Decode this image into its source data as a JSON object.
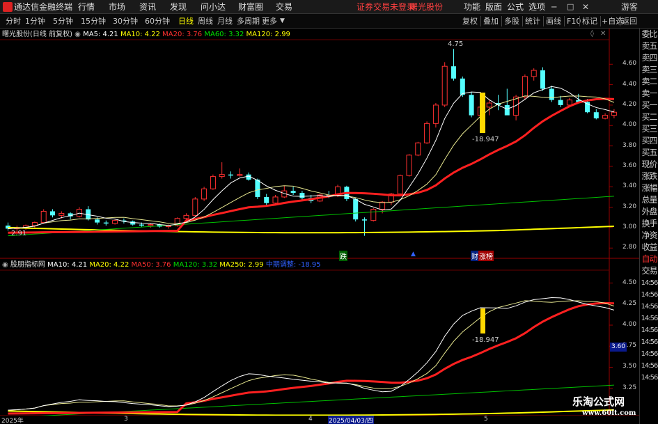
{
  "titlebar": {
    "app_name": "通达信金融终端",
    "menus": [
      "行情",
      "市场",
      "资讯",
      "发现",
      "问小达",
      "财富圈",
      "交易"
    ],
    "notice": "证券交易未登录",
    "stock_name": "曙光股份",
    "right_menus": [
      "功能",
      "版面",
      "公式",
      "选项"
    ],
    "guest": "游客"
  },
  "toolbar": {
    "periods": [
      "分时",
      "1分钟",
      "5分钟",
      "15分钟",
      "30分钟",
      "60分钟",
      "日线",
      "周线",
      "月线",
      "多周期",
      "更多"
    ],
    "active_period": "日线",
    "right_buttons": [
      "复权",
      "叠加",
      "多股",
      "统计",
      "画线",
      "F10",
      "标记",
      "+自选",
      "返回"
    ]
  },
  "main_chart": {
    "title": "曙光股份(日线 前复权)",
    "ma": [
      {
        "label": "MA5: 4.21",
        "color": "#ffffff"
      },
      {
        "label": "MA10: 4.22",
        "color": "#ffff00"
      },
      {
        "label": "MA20: 3.76",
        "color": "#ff3030"
      },
      {
        "label": "MA60: 3.32",
        "color": "#00e000"
      },
      {
        "label": "MA120: 2.99",
        "color": "#ffff00"
      }
    ],
    "high_label": "4.75",
    "low_label": "2.91",
    "marker_value": "-18.947",
    "y_ticks": [
      "4.60",
      "4.40",
      "4.20",
      "4.00",
      "3.80",
      "3.60",
      "3.40",
      "3.20",
      "3.00",
      "2.80"
    ],
    "event_labels": [
      "跌",
      "财",
      "涨榜"
    ]
  },
  "sub_chart": {
    "title": "股朋指标网",
    "ma": [
      {
        "label": "MA10: 4.21",
        "color": "#ffffff"
      },
      {
        "label": "MA20: 4.22",
        "color": "#ffff00"
      },
      {
        "label": "MA50: 3.76",
        "color": "#ff3030"
      },
      {
        "label": "MA120: 3.32",
        "color": "#00e000"
      },
      {
        "label": "MA250: 2.99",
        "color": "#ffff00"
      },
      {
        "label": "中期调整: -18.95",
        "color": "#3060ff"
      }
    ],
    "marker_value": "-18.947",
    "y_ticks": [
      "4.50",
      "4.25",
      "4.00",
      "3.75",
      "3.50",
      "3.25"
    ],
    "current_price_tag": "3.60"
  },
  "x_axis": {
    "labels": [
      "2025年",
      "3",
      "4",
      "2025/04/03/四",
      "5"
    ]
  },
  "right_panel": {
    "tabs": [
      "委比",
      "卖五",
      "卖四",
      "卖三",
      "卖二",
      "卖一",
      "买一",
      "买二",
      "买三",
      "买四",
      "买五",
      "现价",
      "涨跌",
      "涨幅",
      "总量",
      "外盘",
      "换手",
      "净资",
      "收益",
      "自动",
      "交易"
    ],
    "times": [
      "14:56",
      "14:56",
      "14:56",
      "14:56",
      "14:56",
      "14:56",
      "14:56",
      "14:56",
      "14:56"
    ]
  },
  "watermark": {
    "title": "乐淘公式网",
    "url": "www.60lt.com"
  },
  "chart_data": {
    "type": "candlestick",
    "candles": [
      [
        3.02,
        3.05,
        2.97,
        2.99
      ],
      [
        2.99,
        3.02,
        2.96,
        3.0
      ],
      [
        3.0,
        3.03,
        2.98,
        3.02
      ],
      [
        3.02,
        3.06,
        3.0,
        3.05
      ],
      [
        3.05,
        3.18,
        3.04,
        3.16
      ],
      [
        3.16,
        3.18,
        3.1,
        3.12
      ],
      [
        3.12,
        3.16,
        3.09,
        3.14
      ],
      [
        3.14,
        3.15,
        3.08,
        3.11
      ],
      [
        3.11,
        3.2,
        3.1,
        3.18
      ],
      [
        3.18,
        3.21,
        3.07,
        3.08
      ],
      [
        3.08,
        3.1,
        3.03,
        3.05
      ],
      [
        3.05,
        3.07,
        3.02,
        3.04
      ],
      [
        3.04,
        3.08,
        3.03,
        3.07
      ],
      [
        3.07,
        3.09,
        3.04,
        3.06
      ],
      [
        3.06,
        3.07,
        3.02,
        3.03
      ],
      [
        3.03,
        3.05,
        3.01,
        3.02
      ],
      [
        3.02,
        3.04,
        3.0,
        3.03
      ],
      [
        3.03,
        3.04,
        3.0,
        3.01
      ],
      [
        3.01,
        3.03,
        2.99,
        3.02
      ],
      [
        3.02,
        3.1,
        3.01,
        3.09
      ],
      [
        3.09,
        3.14,
        3.07,
        3.12
      ],
      [
        3.12,
        3.3,
        3.11,
        3.28
      ],
      [
        3.28,
        3.4,
        3.26,
        3.38
      ],
      [
        3.38,
        3.52,
        3.37,
        3.5
      ],
      [
        3.5,
        3.64,
        3.48,
        3.52
      ],
      [
        3.52,
        3.55,
        3.48,
        3.51
      ],
      [
        3.51,
        3.58,
        3.5,
        3.52
      ],
      [
        3.52,
        3.54,
        3.46,
        3.47
      ],
      [
        3.47,
        3.48,
        3.28,
        3.3
      ],
      [
        3.3,
        3.33,
        3.21,
        3.24
      ],
      [
        3.24,
        3.32,
        3.23,
        3.3
      ],
      [
        3.3,
        3.41,
        3.29,
        3.36
      ],
      [
        3.36,
        3.4,
        3.32,
        3.34
      ],
      [
        3.34,
        3.36,
        3.27,
        3.29
      ],
      [
        3.29,
        3.32,
        3.24,
        3.26
      ],
      [
        3.26,
        3.33,
        3.25,
        3.32
      ],
      [
        3.32,
        3.36,
        3.29,
        3.31
      ],
      [
        3.31,
        3.42,
        3.3,
        3.4
      ],
      [
        3.4,
        3.41,
        3.26,
        3.28
      ],
      [
        3.28,
        3.29,
        3.06,
        3.08
      ],
      [
        3.08,
        3.1,
        2.92,
        3.07
      ],
      [
        3.07,
        3.19,
        3.06,
        3.18
      ],
      [
        3.18,
        3.26,
        3.14,
        3.25
      ],
      [
        3.25,
        3.34,
        3.22,
        3.33
      ],
      [
        3.33,
        3.52,
        3.32,
        3.51
      ],
      [
        3.51,
        3.72,
        3.5,
        3.71
      ],
      [
        3.71,
        3.84,
        3.7,
        3.83
      ],
      [
        3.83,
        4.04,
        3.82,
        4.02
      ],
      [
        4.02,
        4.22,
        3.98,
        4.2
      ],
      [
        4.2,
        4.62,
        4.18,
        4.58
      ],
      [
        4.58,
        4.75,
        4.44,
        4.46
      ],
      [
        4.46,
        4.48,
        4.28,
        4.3
      ],
      [
        4.3,
        4.33,
        4.08,
        4.1
      ],
      [
        4.1,
        4.2,
        4.0,
        4.18
      ],
      [
        4.18,
        4.25,
        4.1,
        4.22
      ],
      [
        4.22,
        4.3,
        4.15,
        4.2
      ],
      [
        4.2,
        4.36,
        4.16,
        4.1
      ],
      [
        4.1,
        4.3,
        4.05,
        4.28
      ],
      [
        4.28,
        4.5,
        4.25,
        4.48
      ],
      [
        4.48,
        4.56,
        4.44,
        4.54
      ],
      [
        4.54,
        4.57,
        4.34,
        4.36
      ],
      [
        4.36,
        4.39,
        4.23,
        4.25
      ],
      [
        4.25,
        4.29,
        4.18,
        4.2
      ],
      [
        4.2,
        4.27,
        4.18,
        4.25
      ],
      [
        4.25,
        4.31,
        4.22,
        4.23
      ],
      [
        4.23,
        4.26,
        4.12,
        4.13
      ],
      [
        4.13,
        4.16,
        4.06,
        4.07
      ],
      [
        4.07,
        4.12,
        4.06,
        4.1
      ],
      [
        4.1,
        4.16,
        4.07,
        4.13
      ]
    ],
    "ylim": [
      2.72,
      4.82
    ]
  }
}
